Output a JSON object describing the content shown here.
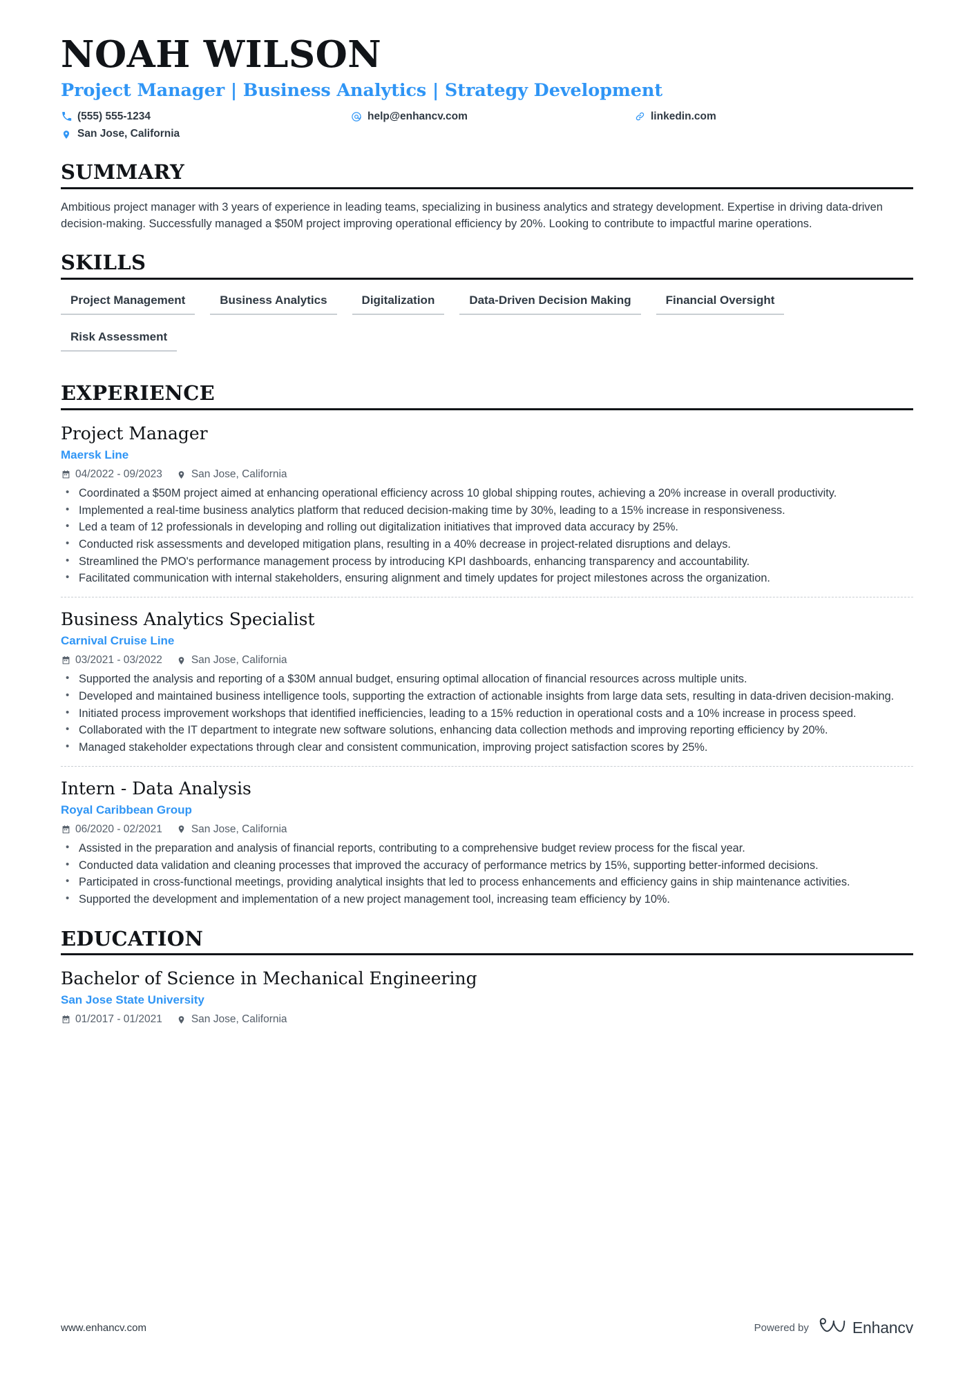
{
  "header": {
    "name": "NOAH WILSON",
    "headline": "Project Manager | Business Analytics | Strategy Development",
    "contacts": [
      {
        "icon": "phone-icon",
        "text": "(555) 555-1234"
      },
      {
        "icon": "email-icon",
        "text": "help@enhancv.com"
      },
      {
        "icon": "link-icon",
        "text": "linkedin.com"
      },
      {
        "icon": "location-icon",
        "text": "San Jose, California"
      }
    ]
  },
  "sections": {
    "summary": {
      "title": "SUMMARY",
      "text": "Ambitious project manager with 3 years of experience in leading teams, specializing in business analytics and strategy development. Expertise in driving data-driven decision-making. Successfully managed a $50M project improving operational efficiency by 20%. Looking to contribute to impactful marine operations."
    },
    "skills": {
      "title": "SKILLS",
      "items": [
        "Project Management",
        "Business Analytics",
        "Digitalization",
        "Data-Driven Decision Making",
        "Financial Oversight",
        "Risk Assessment"
      ]
    },
    "experience": {
      "title": "EXPERIENCE",
      "entries": [
        {
          "title": "Project Manager",
          "org": "Maersk Line",
          "dates": "04/2022 - 09/2023",
          "location": "San Jose, California",
          "bullets": [
            "Coordinated a $50M project aimed at enhancing operational efficiency across 10 global shipping routes, achieving a 20% increase in overall productivity.",
            "Implemented a real-time business analytics platform that reduced decision-making time by 30%, leading to a 15% increase in responsiveness.",
            "Led a team of 12 professionals in developing and rolling out digitalization initiatives that improved data accuracy by 25%.",
            "Conducted risk assessments and developed mitigation plans, resulting in a 40% decrease in project-related disruptions and delays.",
            "Streamlined the PMO's performance management process by introducing KPI dashboards, enhancing transparency and accountability.",
            "Facilitated communication with internal stakeholders, ensuring alignment and timely updates for project milestones across the organization."
          ]
        },
        {
          "title": "Business Analytics Specialist",
          "org": "Carnival Cruise Line",
          "dates": "03/2021 - 03/2022",
          "location": "San Jose, California",
          "bullets": [
            "Supported the analysis and reporting of a $30M annual budget, ensuring optimal allocation of financial resources across multiple units.",
            "Developed and maintained business intelligence tools, supporting the extraction of actionable insights from large data sets, resulting in data-driven decision-making.",
            "Initiated process improvement workshops that identified inefficiencies, leading to a 15% reduction in operational costs and a 10% increase in process speed.",
            "Collaborated with the IT department to integrate new software solutions, enhancing data collection methods and improving reporting efficiency by 20%.",
            "Managed stakeholder expectations through clear and consistent communication, improving project satisfaction scores by 25%."
          ]
        },
        {
          "title": "Intern - Data Analysis",
          "org": "Royal Caribbean Group",
          "dates": "06/2020 - 02/2021",
          "location": "San Jose, California",
          "bullets": [
            "Assisted in the preparation and analysis of financial reports, contributing to a comprehensive budget review process for the fiscal year.",
            "Conducted data validation and cleaning processes that improved the accuracy of performance metrics by 15%, supporting better-informed decisions.",
            "Participated in cross-functional meetings, providing analytical insights that led to process enhancements and efficiency gains in ship maintenance activities.",
            "Supported the development and implementation of a new project management tool, increasing team efficiency by 10%."
          ]
        }
      ]
    },
    "education": {
      "title": "EDUCATION",
      "entries": [
        {
          "title": "Bachelor of Science in Mechanical Engineering",
          "org": "San Jose State University",
          "dates": "01/2017 - 01/2021",
          "location": "San Jose, California"
        }
      ]
    }
  },
  "footer": {
    "url": "www.enhancv.com",
    "powered_by": "Powered by",
    "brand_name": "Enhancv"
  },
  "colors": {
    "accent": "#2f95f5",
    "ink": "#2f3943",
    "heading": "#111418",
    "muted": "#555f6a",
    "rule": "#c9ced3"
  }
}
